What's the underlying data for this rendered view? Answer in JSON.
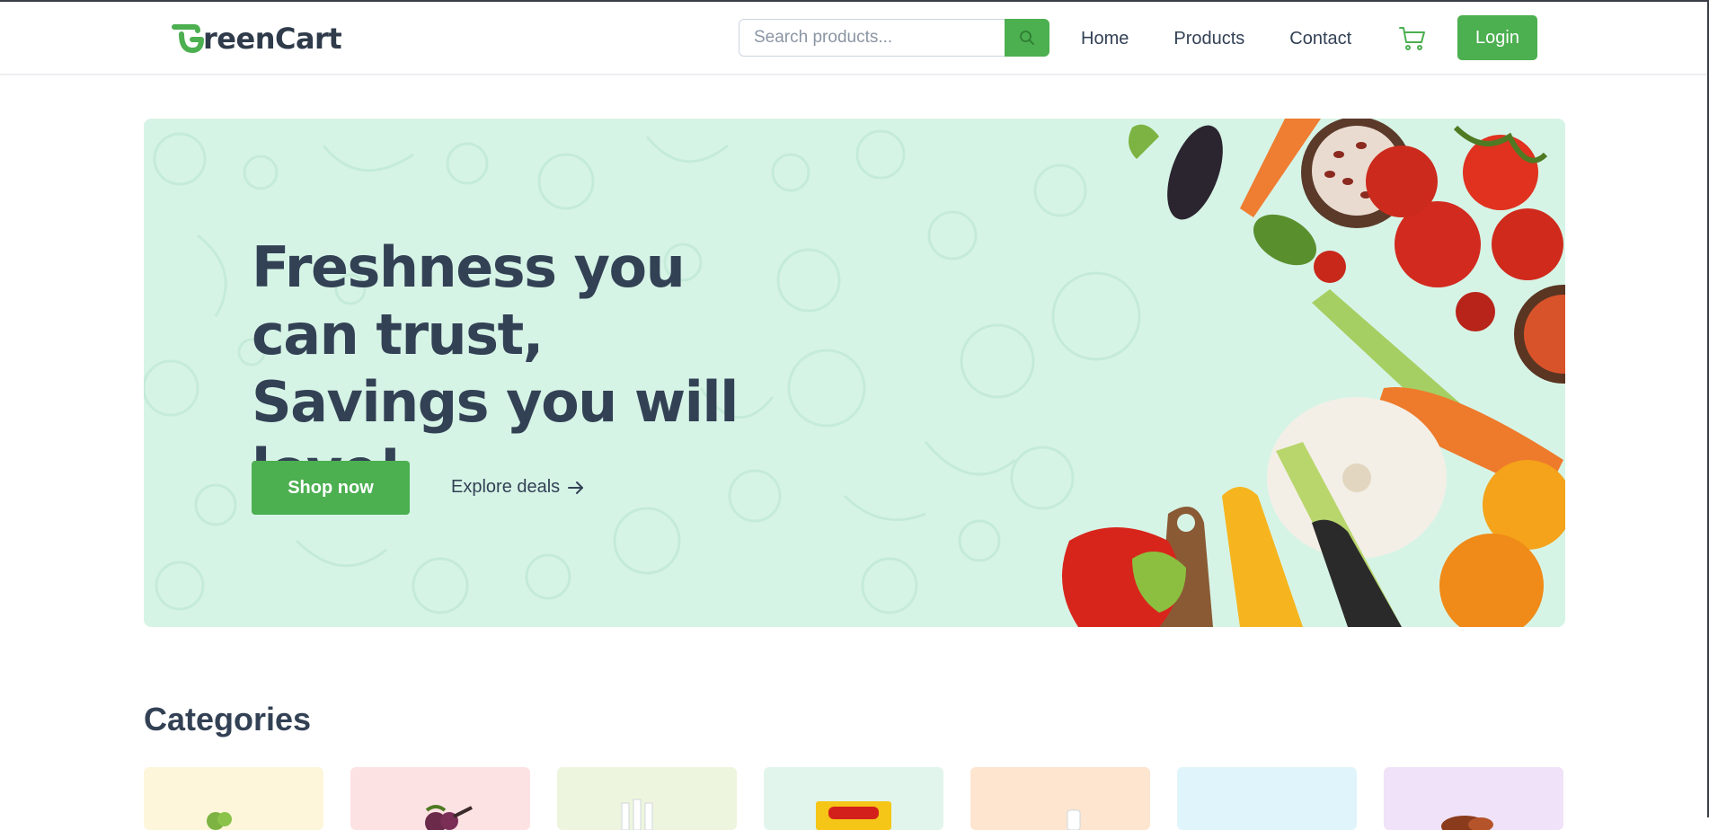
{
  "header": {
    "logo_text": "reenCart",
    "search_placeholder": "Search products...",
    "nav": [
      "Home",
      "Products",
      "Contact"
    ],
    "login_label": "Login"
  },
  "hero": {
    "title": "Freshness you can trust, Savings you will love!",
    "shop_label": "Shop now",
    "explore_label": "Explore deals"
  },
  "categories": {
    "title": "Categories",
    "cards": [
      {
        "color": "#fef6da",
        "icon": "vegetables-icon"
      },
      {
        "color": "#fde2e4",
        "icon": "fruits-icon"
      },
      {
        "color": "#eef5de",
        "icon": "drinks-icon"
      },
      {
        "color": "#e1f5ec",
        "icon": "instant-food-icon"
      },
      {
        "color": "#fde5cf",
        "icon": "dairy-icon"
      },
      {
        "color": "#e0f4fb",
        "icon": "bakery-icon"
      },
      {
        "color": "#f0e2f8",
        "icon": "grains-icon"
      }
    ]
  },
  "colors": {
    "accent": "#4caf50",
    "hero_bg": "#d6f4e6",
    "text": "#334155"
  }
}
